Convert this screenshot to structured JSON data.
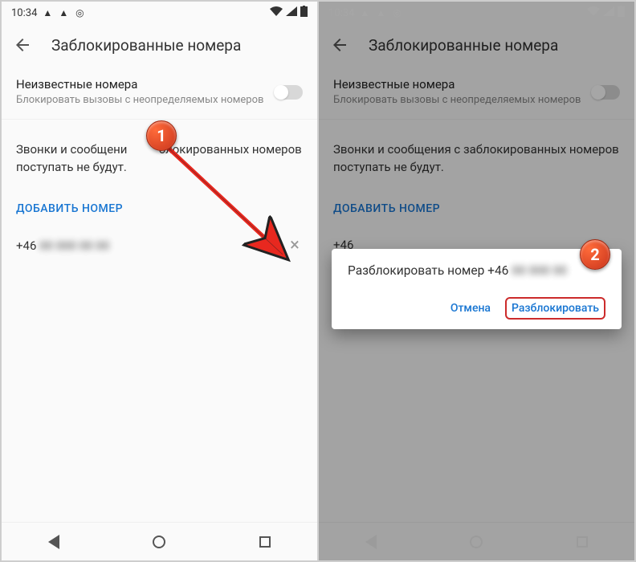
{
  "status": {
    "time": "10:34"
  },
  "header": {
    "title": "Заблокированные номера"
  },
  "settings": {
    "unknown_title": "Неизвестные номера",
    "unknown_sub": "Блокировать вызовы с неопределяемых номеров"
  },
  "info": "Звонки и сообщения с заблокированных номеров поступать не будут.",
  "info_line1": "Звонки и сообщени",
  "info_line1_rest": "блокированных номеров",
  "info_line2": "поступать не будут.",
  "add_label": "ДОБАВИТЬ НОМЕР",
  "number": "+46",
  "dialog": {
    "message_prefix": "Разблокировать номер +46",
    "cancel": "Отмена",
    "confirm": "Разблокировать"
  },
  "badges": {
    "one": "1",
    "two": "2"
  }
}
